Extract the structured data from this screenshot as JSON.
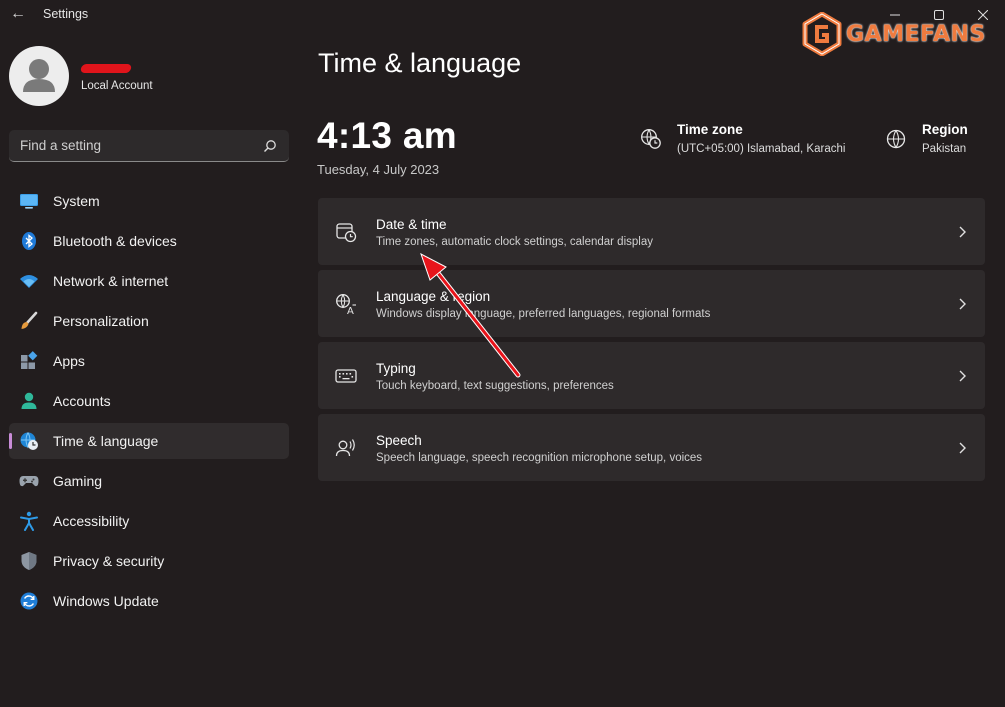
{
  "window": {
    "title": "Settings",
    "back_glyph": "←",
    "minimize_glyph": "—",
    "close_glyph": "✕"
  },
  "watermark": {
    "text": "GAMEFANS",
    "color": "#ef7b3f"
  },
  "profile": {
    "account_type": "Local Account"
  },
  "search": {
    "placeholder": "Find a setting"
  },
  "sidebar": {
    "items": [
      {
        "label": "System",
        "icon": "monitor-icon"
      },
      {
        "label": "Bluetooth & devices",
        "icon": "bluetooth-icon"
      },
      {
        "label": "Network & internet",
        "icon": "wifi-icon"
      },
      {
        "label": "Personalization",
        "icon": "brush-icon"
      },
      {
        "label": "Apps",
        "icon": "apps-icon"
      },
      {
        "label": "Accounts",
        "icon": "person-icon"
      },
      {
        "label": "Time & language",
        "icon": "globe-clock-icon",
        "active": true
      },
      {
        "label": "Gaming",
        "icon": "gamepad-icon"
      },
      {
        "label": "Accessibility",
        "icon": "accessibility-icon"
      },
      {
        "label": "Privacy & security",
        "icon": "shield-icon"
      },
      {
        "label": "Windows Update",
        "icon": "update-icon"
      }
    ]
  },
  "main": {
    "title": "Time & language",
    "time": "4:13 am",
    "date": "Tuesday, 4 July 2023",
    "time_zone": {
      "label": "Time zone",
      "value": "(UTC+05:00) Islamabad, Karachi"
    },
    "region": {
      "label": "Region",
      "value": "Pakistan"
    },
    "cards": [
      {
        "title": "Date & time",
        "description": "Time zones, automatic clock settings, calendar display",
        "icon": "calendar-clock-icon"
      },
      {
        "title": "Language & region",
        "description": "Windows display language, preferred languages, regional formats",
        "icon": "language-icon"
      },
      {
        "title": "Typing",
        "description": "Touch keyboard, text suggestions, preferences",
        "icon": "keyboard-icon"
      },
      {
        "title": "Speech",
        "description": "Speech language, speech recognition microphone setup, voices",
        "icon": "speech-icon"
      }
    ]
  },
  "colors": {
    "background": "#221d1e",
    "card": "#2e2a2b",
    "accent": "#c98dd8",
    "annotation_arrow": "#e8141b"
  }
}
